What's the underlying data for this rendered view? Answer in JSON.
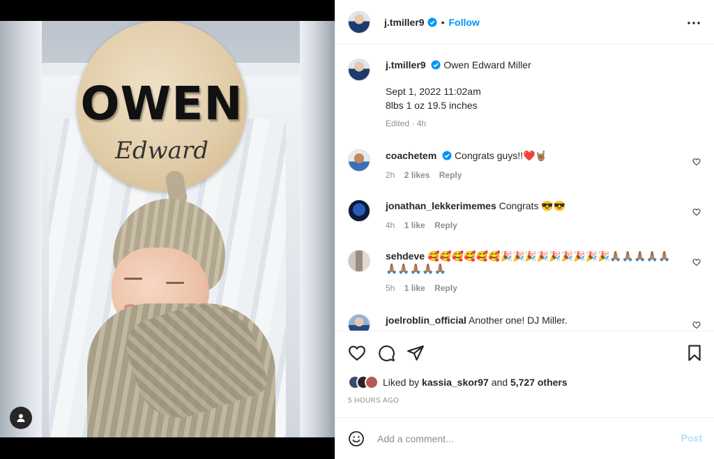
{
  "post": {
    "author": "j.tmiller9",
    "follow_label": "Follow",
    "dot": "•",
    "sign_text": "OWEN",
    "sign_script": "Edward"
  },
  "caption": {
    "author": "j.tmiller9",
    "line1": "Owen Edward Miller",
    "line2": "Sept 1, 2022 11:02am",
    "line3": "8lbs 1 oz 19.5 inches",
    "meta": "Edited · 4h"
  },
  "comments": [
    {
      "author": "coachetem",
      "verified": true,
      "text": "Congrats guys!!❤️🤘🏽",
      "time": "2h",
      "likes": "2 likes",
      "reply": "Reply"
    },
    {
      "author": "jonathan_lekkerimemes",
      "verified": false,
      "text": "Congrats 😎😎",
      "time": "4h",
      "likes": "1 like",
      "reply": "Reply"
    },
    {
      "author": "sehdeve",
      "verified": false,
      "text": "🥰🥰🥰🥰🥰🥰🎉🎉🎉🎉🎉🎉🎉🎉🎉🙏🏽🙏🏽🙏🏽🙏🏽🙏🏽🙏🏽🙏🏽🙏🏽🙏🏽🙏🏽",
      "time": "5h",
      "likes": "1 like",
      "reply": "Reply"
    },
    {
      "author": "joelroblin_official",
      "verified": false,
      "text": "Another one! DJ Miller.",
      "time": "",
      "likes": "",
      "reply": ""
    }
  ],
  "likes": {
    "prefix": "Liked by",
    "user": "kassia_skor97",
    "and": "and",
    "others": "5,727 others",
    "time_ago": "5 HOURS AGO"
  },
  "add_comment": {
    "placeholder": "Add a comment...",
    "post_label": "Post"
  },
  "colors": {
    "accent": "#0095f6",
    "post_disabled": "#b2dffc",
    "muted": "#8e8e8e"
  },
  "icons": [
    "user-tag-icon",
    "verified-badge-icon",
    "more-options-icon",
    "heart-icon",
    "comment-icon",
    "share-icon",
    "bookmark-icon",
    "emoji-icon"
  ]
}
